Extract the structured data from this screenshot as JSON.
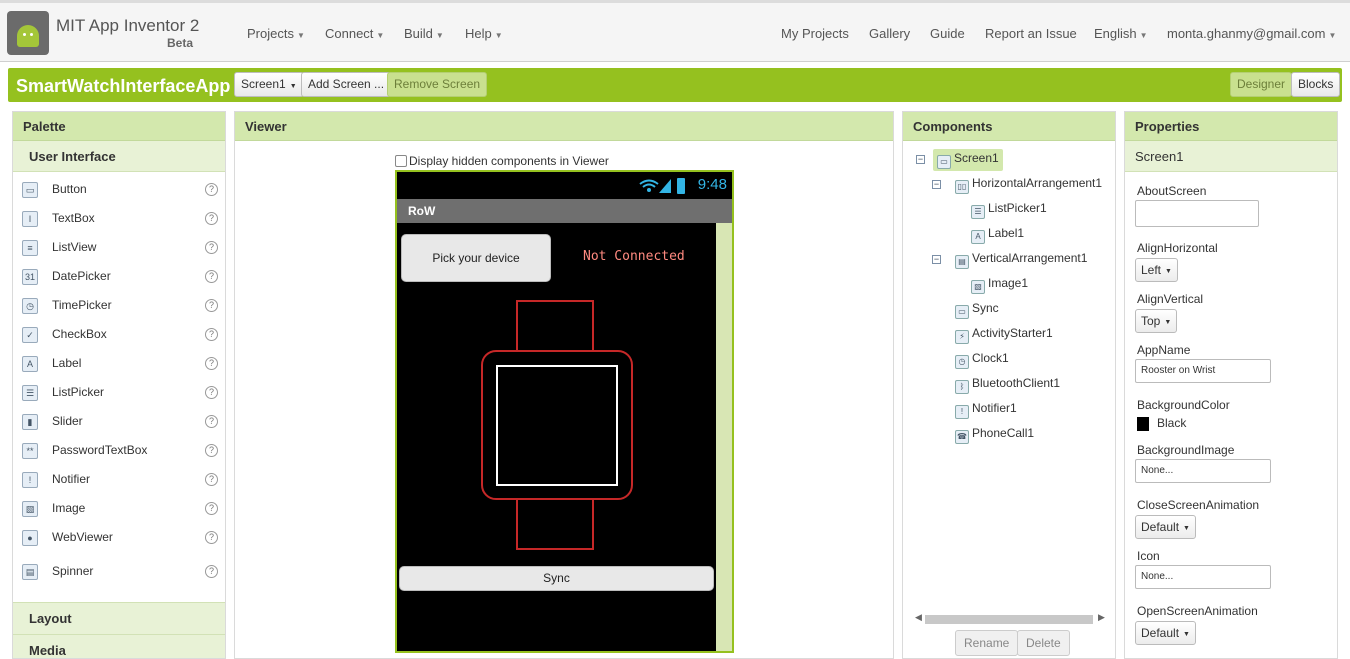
{
  "topbar": {
    "app_title": "MIT App Inventor 2",
    "beta": "Beta",
    "menus": [
      "Projects",
      "Connect",
      "Build",
      "Help"
    ],
    "links": [
      "My Projects",
      "Gallery",
      "Guide",
      "Report an Issue"
    ],
    "language": "English",
    "account": "monta.ghanmy@gmail.com"
  },
  "projectbar": {
    "project_name": "SmartWatchInterfaceApp",
    "screen_select": "Screen1",
    "add_screen": "Add Screen ...",
    "remove_screen": "Remove Screen",
    "designer": "Designer",
    "blocks": "Blocks"
  },
  "palette": {
    "title": "Palette",
    "group": "User Interface",
    "items": [
      {
        "label": "Button",
        "icon": "button-icon"
      },
      {
        "label": "TextBox",
        "icon": "textbox-icon"
      },
      {
        "label": "ListView",
        "icon": "listview-icon"
      },
      {
        "label": "DatePicker",
        "icon": "datepicker-icon"
      },
      {
        "label": "TimePicker",
        "icon": "timepicker-icon"
      },
      {
        "label": "CheckBox",
        "icon": "checkbox-icon"
      },
      {
        "label": "Label",
        "icon": "label-icon"
      },
      {
        "label": "ListPicker",
        "icon": "listpicker-icon"
      },
      {
        "label": "Slider",
        "icon": "slider-icon"
      },
      {
        "label": "PasswordTextBox",
        "icon": "passwordtextbox-icon"
      },
      {
        "label": "Notifier",
        "icon": "notifier-icon"
      },
      {
        "label": "Image",
        "icon": "image-icon"
      },
      {
        "label": "WebViewer",
        "icon": "webviewer-icon"
      },
      {
        "label": "Spinner",
        "icon": "spinner-icon"
      }
    ],
    "help_glyph": "?",
    "sections": [
      "Layout",
      "Media"
    ]
  },
  "viewer": {
    "title": "Viewer",
    "display_hidden": "Display hidden components in Viewer",
    "time": "9:48",
    "screen_title": "RoW",
    "pick_button": "Pick your device",
    "status_label": "Not Connected",
    "sync_button": "Sync"
  },
  "components": {
    "title": "Components",
    "tree": [
      {
        "label": "Screen1",
        "icon": "screen-icon"
      },
      {
        "label": "HorizontalArrangement1",
        "icon": "horizontal-arrangement-icon"
      },
      {
        "label": "ListPicker1",
        "icon": "listpicker-icon"
      },
      {
        "label": "Label1",
        "icon": "label-icon"
      },
      {
        "label": "VerticalArrangement1",
        "icon": "vertical-arrangement-icon"
      },
      {
        "label": "Image1",
        "icon": "image-icon"
      },
      {
        "label": "Sync",
        "icon": "button-icon"
      },
      {
        "label": "ActivityStarter1",
        "icon": "activity-starter-icon"
      },
      {
        "label": "Clock1",
        "icon": "clock-icon"
      },
      {
        "label": "BluetoothClient1",
        "icon": "bluetooth-icon"
      },
      {
        "label": "Notifier1",
        "icon": "notifier-icon"
      },
      {
        "label": "PhoneCall1",
        "icon": "phonecall-icon"
      }
    ],
    "rename": "Rename",
    "delete": "Delete"
  },
  "properties": {
    "title": "Properties",
    "component": "Screen1",
    "about_screen": "AboutScreen",
    "align_horizontal": "AlignHorizontal",
    "align_horizontal_value": "Left",
    "align_vertical": "AlignVertical",
    "align_vertical_value": "Top",
    "app_name": "AppName",
    "app_name_value": "Rooster on Wrist",
    "background_color": "BackgroundColor",
    "background_color_value": "Black",
    "background_image": "BackgroundImage",
    "background_image_value": "None...",
    "close_screen_animation": "CloseScreenAnimation",
    "close_screen_animation_value": "Default",
    "icon": "Icon",
    "icon_value": "None...",
    "open_screen_animation": "OpenScreenAnimation",
    "open_screen_animation_value": "Default"
  },
  "colors": {
    "accent": "#95c11f",
    "panel_header": "#d3e8ad",
    "status_text": "#ff8a80",
    "clock_text": "#33b5e5",
    "watch_band": "#c62828"
  }
}
